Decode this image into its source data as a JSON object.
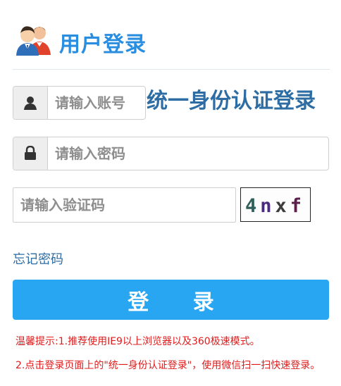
{
  "header": {
    "title": "用户登录",
    "icon": "users-icon"
  },
  "login_form": {
    "account_placeholder": "请输入账号",
    "account_icon": "user-icon",
    "password_placeholder": "请输入密码",
    "password_icon": "lock-icon",
    "captcha_placeholder": "请输入验证码",
    "captcha_text": "4nxf",
    "unified_login": "统一身份认证登录",
    "forgot_password": "忘记密码",
    "submit_label": "登 录"
  },
  "tips": {
    "line1": "温馨提示:1.推荐使用IE9以上浏览器以及360极速模式。",
    "line2": "2.点击登录页面上的\"统一身份认证登录\"，使用微信扫一扫快速登录。"
  },
  "colors": {
    "accent": "#29a6f2",
    "title": "#2a8ee0",
    "link": "#2e6da4",
    "warning": "#e01b1b"
  }
}
